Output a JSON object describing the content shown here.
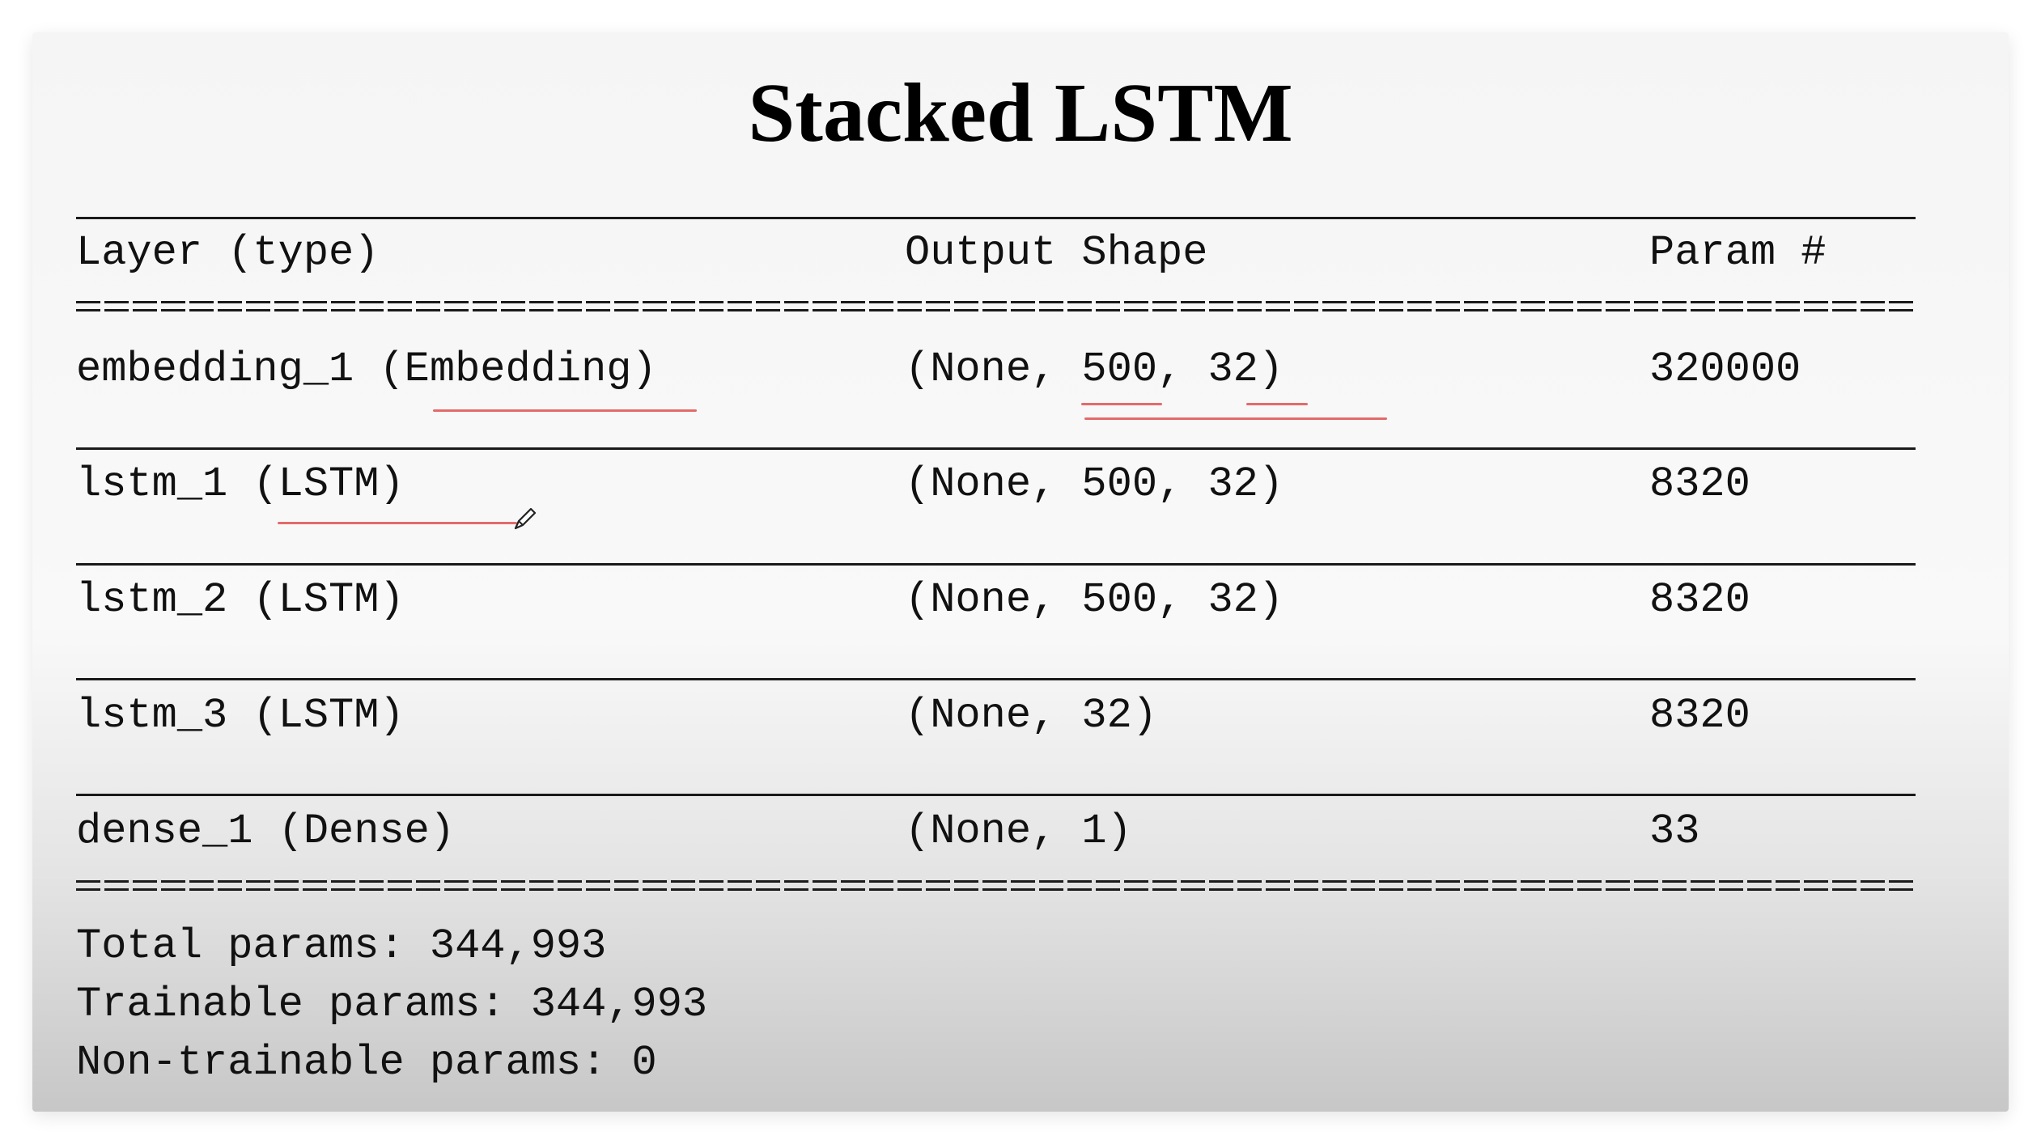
{
  "title": "Stacked LSTM",
  "table": {
    "headers": [
      "Layer (type)",
      "Output Shape",
      "Param #"
    ],
    "rows": [
      {
        "layer": "embedding_1 (Embedding)",
        "shape": "(None, 500, 32)",
        "params": "320000"
      },
      {
        "layer": "lstm_1 (LSTM)",
        "shape": "(None, 500, 32)",
        "params": "8320"
      },
      {
        "layer": "lstm_2 (LSTM)",
        "shape": "(None, 500, 32)",
        "params": "8320"
      },
      {
        "layer": "lstm_3 (LSTM)",
        "shape": "(None, 32)",
        "params": "8320"
      },
      {
        "layer": "dense_1 (Dense)",
        "shape": "(None, 1)",
        "params": "33"
      }
    ]
  },
  "summary": {
    "total": "Total params: 344,993",
    "trainable": "Trainable params: 344,993",
    "non_trainable": "Non-trainable params: 0"
  },
  "annotation_color": "#e46a6a",
  "icons": [
    "pencil-icon"
  ]
}
